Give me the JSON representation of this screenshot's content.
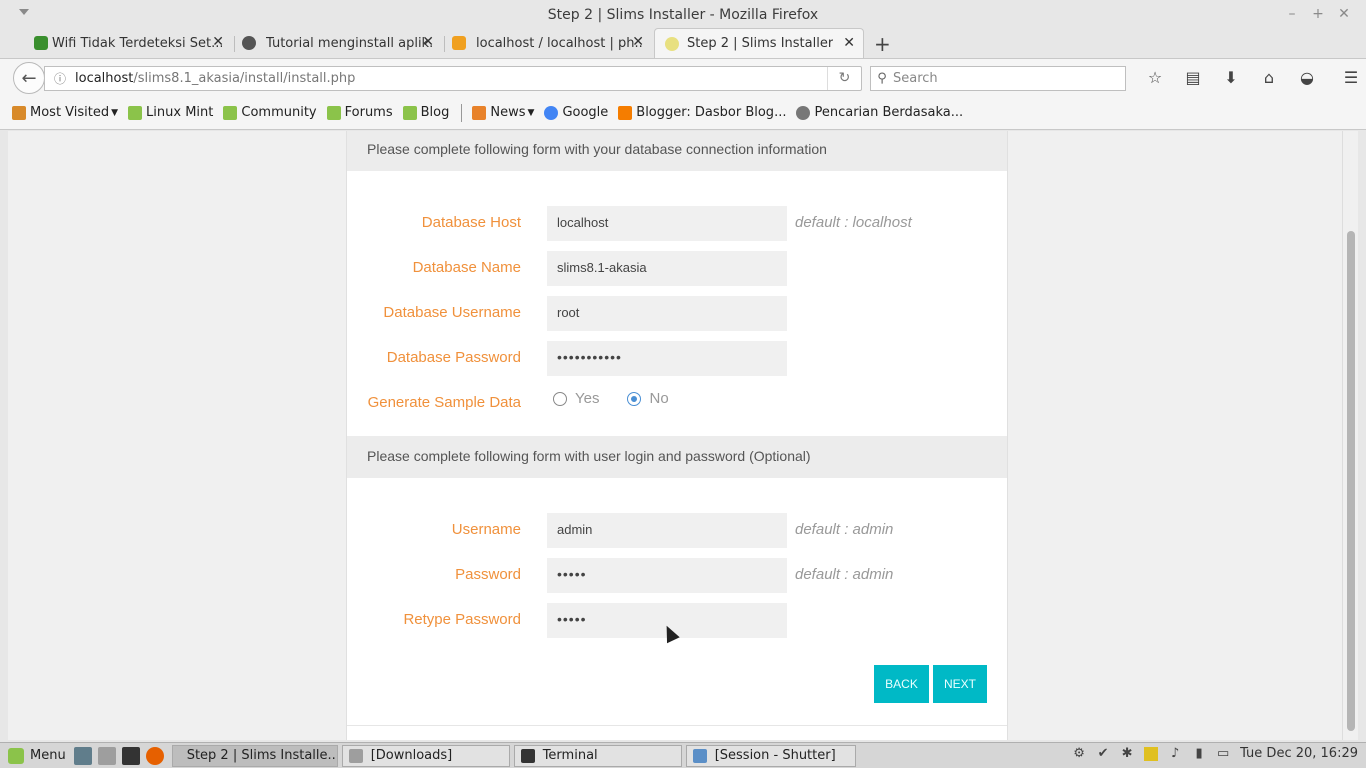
{
  "window": {
    "title": "Step 2 | Slims Installer - Mozilla Firefox"
  },
  "tabs": [
    {
      "label": "Wifi Tidak Terdeteksi Set...",
      "favicon_color": "#3a8f2e"
    },
    {
      "label": "Tutorial menginstall aplik...",
      "favicon_color": "#555555"
    },
    {
      "label": "localhost / localhost | ph...",
      "favicon_color": "#f0a020"
    },
    {
      "label": "Step 2 | Slims Installer",
      "favicon_color": "#e8e080",
      "active": true
    }
  ],
  "navbar": {
    "url_host": "localhost",
    "url_path": "/slims8.1_akasia/install/install.php",
    "search_placeholder": "Search"
  },
  "bookmarks": [
    {
      "label": "Most Visited",
      "dropdown": true
    },
    {
      "label": "Linux Mint"
    },
    {
      "label": "Community"
    },
    {
      "label": "Forums"
    },
    {
      "label": "Blog"
    },
    {
      "label": "News",
      "dropdown": true
    },
    {
      "label": "Google"
    },
    {
      "label": "Blogger: Dasbor Blog..."
    },
    {
      "label": "Pencarian Berdasaka..."
    }
  ],
  "form": {
    "db_section_title": "Please complete following form with your database connection information",
    "db_host": {
      "label": "Database Host",
      "value": "localhost",
      "hint": "default : localhost"
    },
    "db_name": {
      "label": "Database Name",
      "value": "slims8.1-akasia"
    },
    "db_user": {
      "label": "Database Username",
      "value": "root"
    },
    "db_pass": {
      "label": "Database Password",
      "value": "•••••••••••"
    },
    "sample": {
      "label": "Generate Sample Data",
      "yes": "Yes",
      "no": "No",
      "selected": "No"
    },
    "user_section_title": "Please complete following form with user login and password (Optional)",
    "username": {
      "label": "Username",
      "value": "admin",
      "hint": "default : admin"
    },
    "password": {
      "label": "Password",
      "value": "•••••",
      "hint": "default : admin"
    },
    "retype": {
      "label": "Retype Password",
      "value": "•••••"
    },
    "back_label": "BACK",
    "next_label": "NEXT"
  },
  "taskbar": {
    "menu_label": "Menu",
    "windows": [
      {
        "label": "Step 2 | Slims Installe...",
        "active": true
      },
      {
        "label": "[Downloads]"
      },
      {
        "label": "Terminal"
      },
      {
        "label": "[Session - Shutter]"
      }
    ],
    "clock": "Tue Dec 20, 16:29"
  }
}
